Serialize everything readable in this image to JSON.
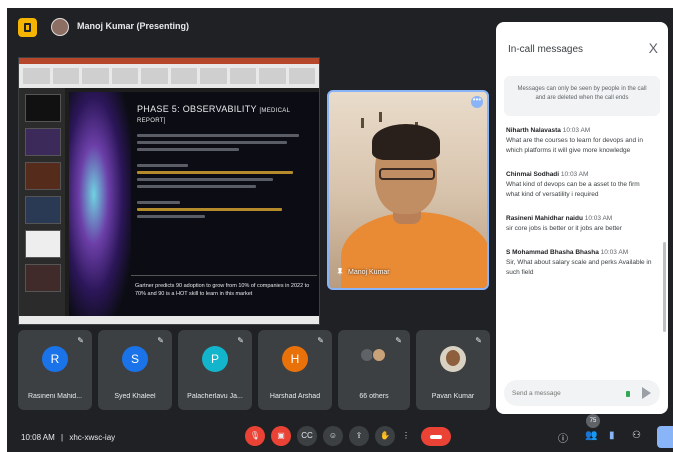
{
  "top": {
    "presenter_label": "Manoj Kumar (Presenting)"
  },
  "slide": {
    "title": "PHASE 5: OBSERVABILITY",
    "title_suffix": "[MEDICAL REPORT]",
    "footer": "Gartner predicts 90 adoption to grow from 10% of companies in 2022 to 70% and 90 is a HOT skill to learn in this market"
  },
  "camera": {
    "name": "Manoj Kumar"
  },
  "participants": [
    {
      "initial": "R",
      "name": "Rasineni Mahid...",
      "color": "#1a73e8"
    },
    {
      "initial": "S",
      "name": "Syed Khaleel",
      "color": "#1a73e8"
    },
    {
      "initial": "P",
      "name": "Palacherlavu Ja...",
      "color": "#12b5cb"
    },
    {
      "initial": "H",
      "name": "Harshad Arshad",
      "color": "#e8710a"
    },
    {
      "initial": "",
      "name": "66 others",
      "color": ""
    },
    {
      "initial": "",
      "name": "Pavan Kumar",
      "color": ""
    }
  ],
  "chat": {
    "title": "In-call messages",
    "close": "X",
    "note": "Messages can only be seen by people in the call and are deleted when the call ends",
    "messages": [
      {
        "sender": "Niharth Nalavasta",
        "time": "10:03 AM",
        "text": "What are the courses to learn for devops and in which platforms it will give more knowledge"
      },
      {
        "sender": "Chinmai Sodhadi",
        "time": "10:03 AM",
        "text": "What kind of devops can be a asset to the firm what kind of versatility i required"
      },
      {
        "sender": "Rasineni Mahidhar naidu",
        "time": "10:03 AM",
        "text": "sir core jobs is better or it jobs are better"
      },
      {
        "sender": "S Mohammad Bhasha Bhasha",
        "time": "10:03 AM",
        "text": "Sir, What about salary scale and perks Available in such field"
      }
    ],
    "compose_placeholder": "Send a message"
  },
  "bottom": {
    "time": "10:08 AM",
    "separator": "|",
    "meeting_code": "xhc-xwsc-iay",
    "people_badge": "75"
  },
  "colors": {
    "accent": "#8ab4f8",
    "danger": "#ea4335",
    "bg": "#202124",
    "tile": "#3c4043"
  }
}
